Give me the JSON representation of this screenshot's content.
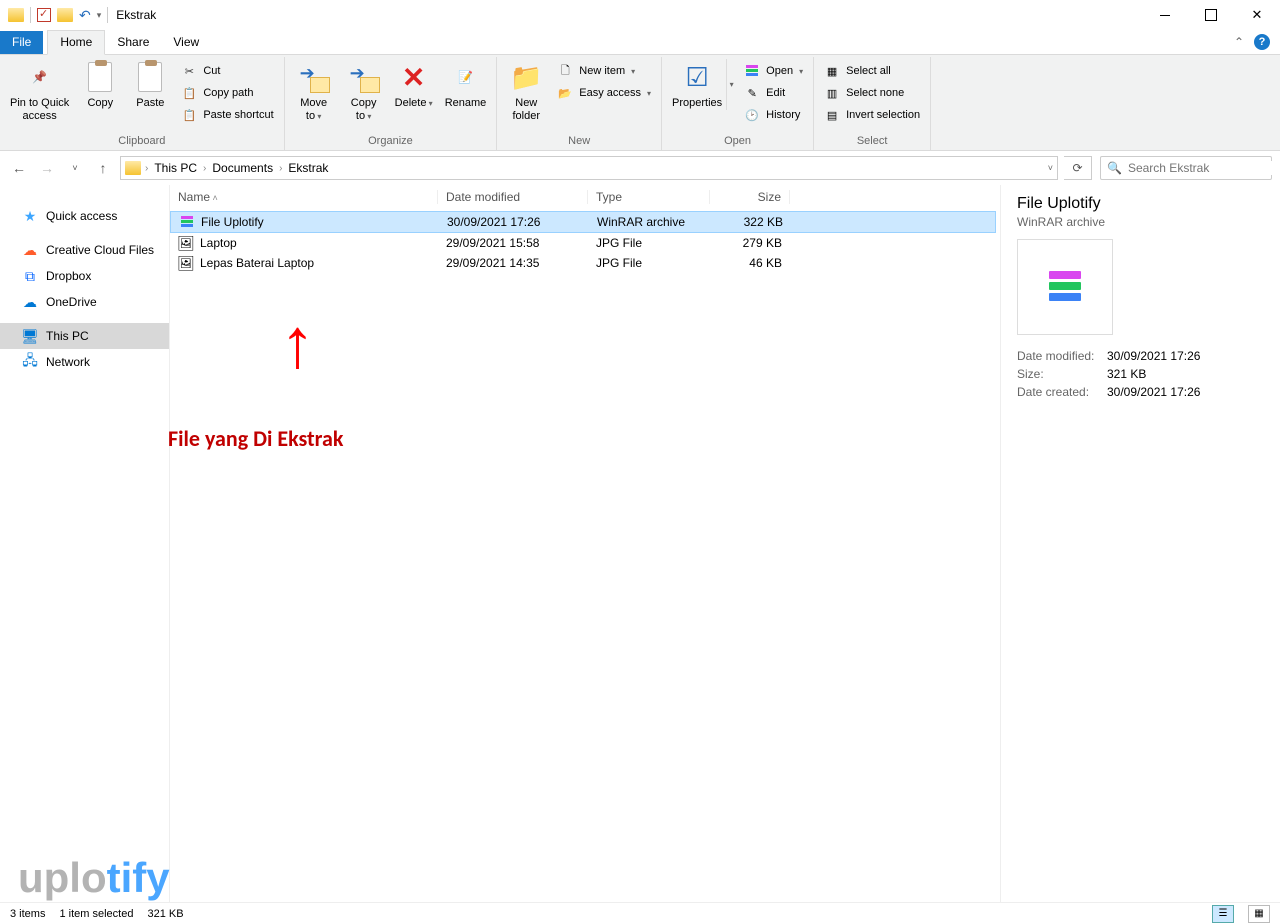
{
  "window": {
    "title": "Ekstrak"
  },
  "tabs": {
    "file": "File",
    "home": "Home",
    "share": "Share",
    "view": "View"
  },
  "ribbon": {
    "clipboard": {
      "pin": "Pin to Quick\naccess",
      "copy": "Copy",
      "paste": "Paste",
      "cut": "Cut",
      "copy_path": "Copy path",
      "paste_shortcut": "Paste shortcut",
      "label": "Clipboard"
    },
    "organize": {
      "move_to": "Move\nto",
      "copy_to": "Copy\nto",
      "delete": "Delete",
      "rename": "Rename",
      "label": "Organize"
    },
    "new": {
      "new_folder": "New\nfolder",
      "new_item": "New item",
      "easy_access": "Easy access",
      "label": "New"
    },
    "open": {
      "properties": "Properties",
      "open": "Open",
      "edit": "Edit",
      "history": "History",
      "label": "Open"
    },
    "select": {
      "select_all": "Select all",
      "select_none": "Select none",
      "invert": "Invert selection",
      "label": "Select"
    }
  },
  "breadcrumb": {
    "items": [
      "This PC",
      "Documents",
      "Ekstrak"
    ]
  },
  "search": {
    "placeholder": "Search Ekstrak"
  },
  "sidebar": {
    "items": [
      {
        "label": "Quick access",
        "icon": "star",
        "color": "#3ea6ff"
      },
      {
        "label": "Creative Cloud Files",
        "icon": "cloud",
        "color": "#ff5c2b"
      },
      {
        "label": "Dropbox",
        "icon": "dropbox",
        "color": "#0061ff"
      },
      {
        "label": "OneDrive",
        "icon": "cloud",
        "color": "#0078d4"
      },
      {
        "label": "This PC",
        "icon": "pc",
        "color": "#0078d4",
        "selected": true
      },
      {
        "label": "Network",
        "icon": "network",
        "color": "#0078d4"
      }
    ]
  },
  "columns": {
    "name": "Name",
    "date": "Date modified",
    "type": "Type",
    "size": "Size"
  },
  "files": [
    {
      "name": "File Uplotify",
      "date": "30/09/2021 17:26",
      "type": "WinRAR archive",
      "size": "322 KB",
      "icon": "rar",
      "selected": true
    },
    {
      "name": "Laptop",
      "date": "29/09/2021 15:58",
      "type": "JPG File",
      "size": "279 KB",
      "icon": "jpg"
    },
    {
      "name": "Lepas Baterai Laptop",
      "date": "29/09/2021 14:35",
      "type": "JPG File",
      "size": "46 KB",
      "icon": "jpg"
    }
  ],
  "details": {
    "title": "File Uplotify",
    "subtitle": "WinRAR archive",
    "rows": [
      {
        "k": "Date modified:",
        "v": "30/09/2021 17:26"
      },
      {
        "k": "Size:",
        "v": "321 KB"
      },
      {
        "k": "Date created:",
        "v": "30/09/2021 17:26"
      }
    ]
  },
  "status": {
    "count": "3 items",
    "selected": "1 item selected",
    "size": "321 KB"
  },
  "annotation": {
    "text": "File yang Di Ekstrak"
  },
  "watermark": {
    "a": "uplo",
    "b": "tify"
  }
}
